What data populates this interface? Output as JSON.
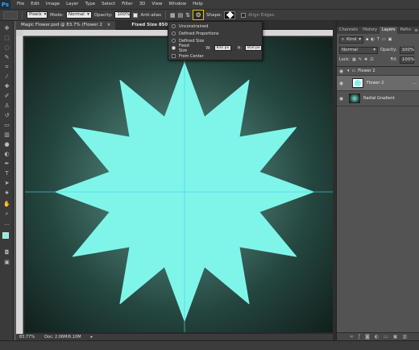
{
  "menubar": {
    "logo": "Ps",
    "items": [
      "File",
      "Edit",
      "Image",
      "Layer",
      "Type",
      "Select",
      "Filter",
      "3D",
      "View",
      "Window",
      "Help"
    ]
  },
  "options": {
    "pixels_value": "Pixels",
    "mode_label": "Mode:",
    "mode_value": "Normal",
    "opacity_label": "Opacity:",
    "opacity_value": "100%",
    "antialias_label": "Anti-alias",
    "shape_label": "Shape:",
    "align_edges_label": "Align Edges"
  },
  "document": {
    "tab_title": "Magic Flower.psd @ 83.7% (Flower 2",
    "tab_info": "Fixed Size 850/850",
    "zoom": "83.77%",
    "doc_size": "Doc: 2.06M/6.10M"
  },
  "popup": {
    "options": [
      "Unconstrained",
      "Defined Proportions",
      "Defined Size",
      "Fixed Size",
      "From Center"
    ],
    "selected": "Fixed Size",
    "w_label": "W:",
    "w_value": "850 px",
    "h_label": "H:",
    "h_value": "850 px"
  },
  "panel": {
    "tabs": [
      "Channels",
      "History",
      "Layers",
      "Paths"
    ],
    "active_tab": "Layers",
    "filter_value": "Kind",
    "blend_value": "Normal",
    "opacity_label": "Opacity:",
    "opacity_value": "100%",
    "lock_label": "Lock:",
    "fill_label": "Fill:",
    "fill_value": "100%",
    "layers": [
      {
        "name": "Flower 2",
        "type": "group"
      },
      {
        "name": "Flower 2",
        "type": "shape"
      },
      {
        "name": "Radial Gradient",
        "type": "fill"
      }
    ]
  },
  "colors": {
    "flower": "#7ff5ea",
    "guide": "#45d6e0",
    "highlight": "#e3c412"
  }
}
